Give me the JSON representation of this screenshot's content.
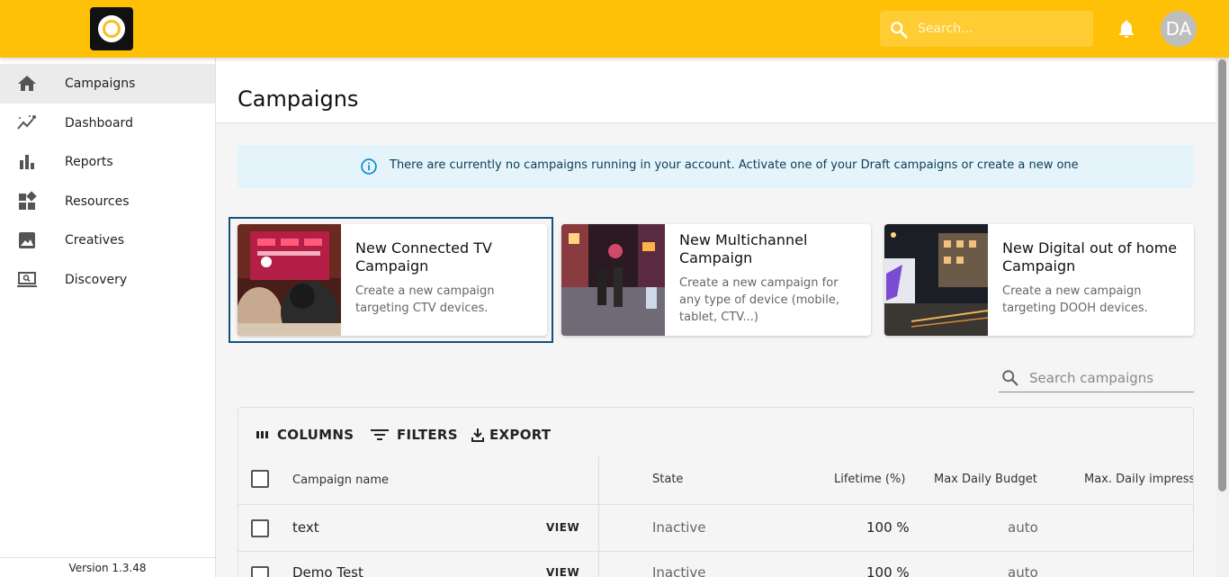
{
  "topbar": {
    "search_placeholder": "Search...",
    "avatar_initials": "DA"
  },
  "sidebar": {
    "items": [
      {
        "label": "Campaigns",
        "icon": "home-icon",
        "active": true
      },
      {
        "label": "Dashboard",
        "icon": "trending-icon"
      },
      {
        "label": "Reports",
        "icon": "bar-chart-icon"
      },
      {
        "label": "Resources",
        "icon": "widgets-icon"
      },
      {
        "label": "Creatives",
        "icon": "image-icon"
      },
      {
        "label": "Discovery",
        "icon": "laptop-search-icon"
      }
    ],
    "version": "Version 1.3.48"
  },
  "main": {
    "title": "Campaigns",
    "alert": "There are currently no campaigns running in your account. Activate one of your Draft campaigns or create a new one",
    "cards": [
      {
        "title": "New Connected TV Campaign",
        "description": "Create a new campaign targeting CTV devices."
      },
      {
        "title": "New Multichannel Campaign",
        "description": "Create a new campaign for any type of device (mobile, tablet, CTV...)"
      },
      {
        "title": "New Digital out of home Campaign",
        "description": "Create a new campaign targeting DOOH devices."
      }
    ],
    "search_campaigns_placeholder": "Search campaigns"
  },
  "grid": {
    "toolbar": {
      "columns": "COLUMNS",
      "filters": "FILTERS",
      "export": "EXPORT"
    },
    "columns": [
      "Campaign name",
      "State",
      "Lifetime (%)",
      "Max Daily Budget",
      "Max. Daily impress"
    ],
    "view_label": "VIEW",
    "rows": [
      {
        "name": "text",
        "state": "Inactive",
        "lifetime": "100 %",
        "budget": "auto"
      },
      {
        "name": "Demo Test",
        "state": "Inactive",
        "lifetime": "100 %",
        "budget": "auto"
      }
    ]
  },
  "colors": {
    "brand": "#ffc107",
    "alert_bg": "#e5f4fb",
    "selected_outline": "#14527a"
  }
}
